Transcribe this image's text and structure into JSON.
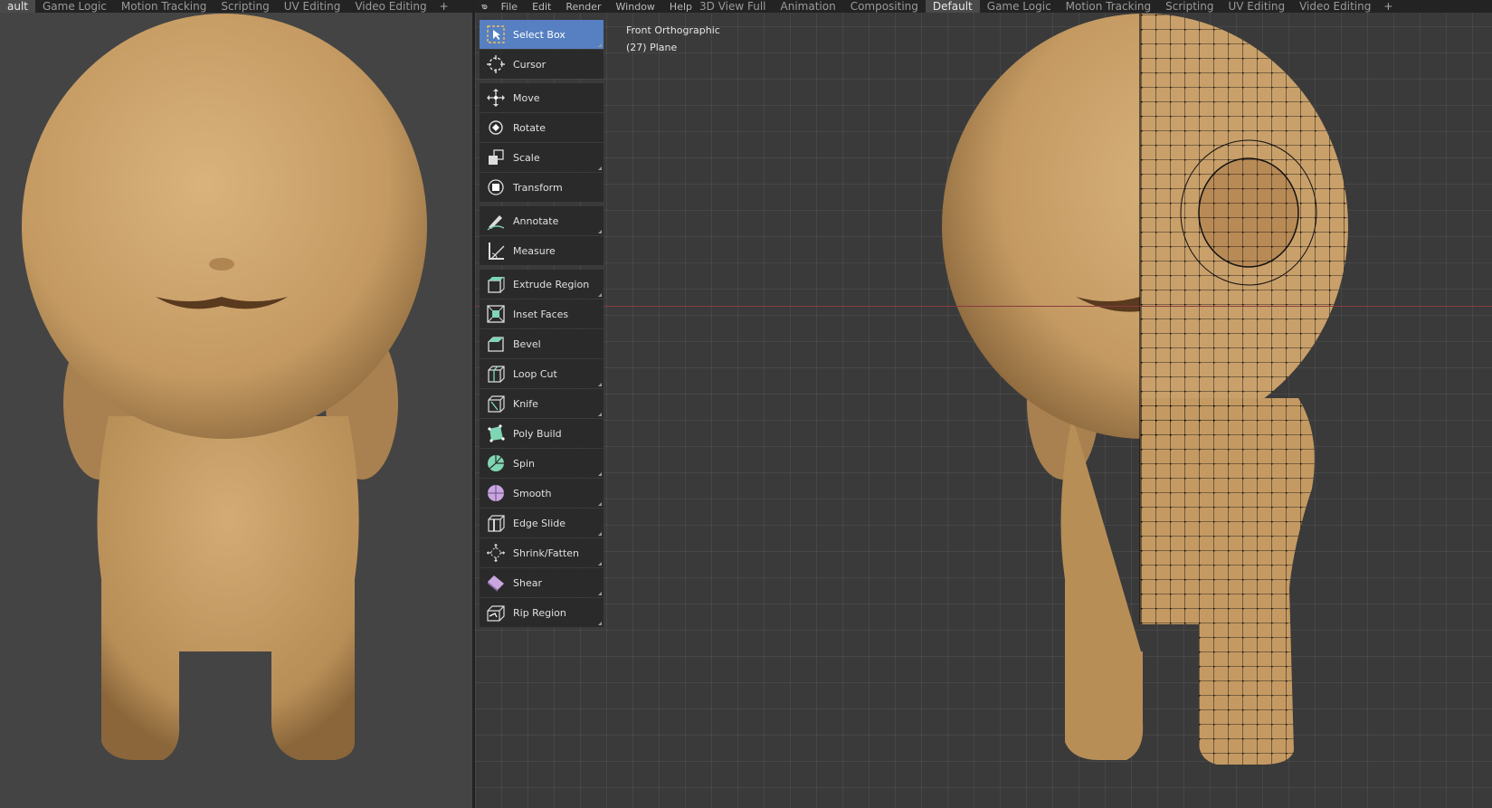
{
  "left_tabs": [
    "ault",
    "Game Logic",
    "Motion Tracking",
    "Scripting",
    "UV Editing",
    "Video Editing"
  ],
  "menu": [
    "File",
    "Edit",
    "Render",
    "Window",
    "Help"
  ],
  "workspace_tabs": [
    "3D View Full",
    "Animation",
    "Compositing",
    "Default",
    "Game Logic",
    "Motion Tracking",
    "Scripting",
    "UV Editing",
    "Video Editing"
  ],
  "active_workspace": "Default",
  "viewport": {
    "view_name": "Front Orthographic",
    "object_label": "(27) Plane"
  },
  "tools": [
    {
      "label": "Select Box",
      "icon": "select-box-icon",
      "active": true
    },
    {
      "label": "Cursor",
      "icon": "cursor-icon"
    },
    {
      "label": "Move",
      "icon": "move-icon"
    },
    {
      "label": "Rotate",
      "icon": "rotate-icon"
    },
    {
      "label": "Scale",
      "icon": "scale-icon"
    },
    {
      "label": "Transform",
      "icon": "transform-icon"
    },
    {
      "label": "Annotate",
      "icon": "annotate-icon"
    },
    {
      "label": "Measure",
      "icon": "measure-icon"
    },
    {
      "label": "Extrude Region",
      "icon": "extrude-region-icon"
    },
    {
      "label": "Inset Faces",
      "icon": "inset-faces-icon"
    },
    {
      "label": "Bevel",
      "icon": "bevel-icon"
    },
    {
      "label": "Loop Cut",
      "icon": "loop-cut-icon"
    },
    {
      "label": "Knife",
      "icon": "knife-icon"
    },
    {
      "label": "Poly Build",
      "icon": "poly-build-icon"
    },
    {
      "label": "Spin",
      "icon": "spin-icon"
    },
    {
      "label": "Smooth",
      "icon": "smooth-icon"
    },
    {
      "label": "Edge Slide",
      "icon": "edge-slide-icon"
    },
    {
      "label": "Shrink/Fatten",
      "icon": "shrink-fatten-icon"
    },
    {
      "label": "Shear",
      "icon": "shear-icon"
    },
    {
      "label": "Rip Region",
      "icon": "rip-region-icon"
    }
  ],
  "colors": {
    "model": "#c9a06a",
    "accent": "#5680c2",
    "x_axis": "#8a3a3f"
  }
}
